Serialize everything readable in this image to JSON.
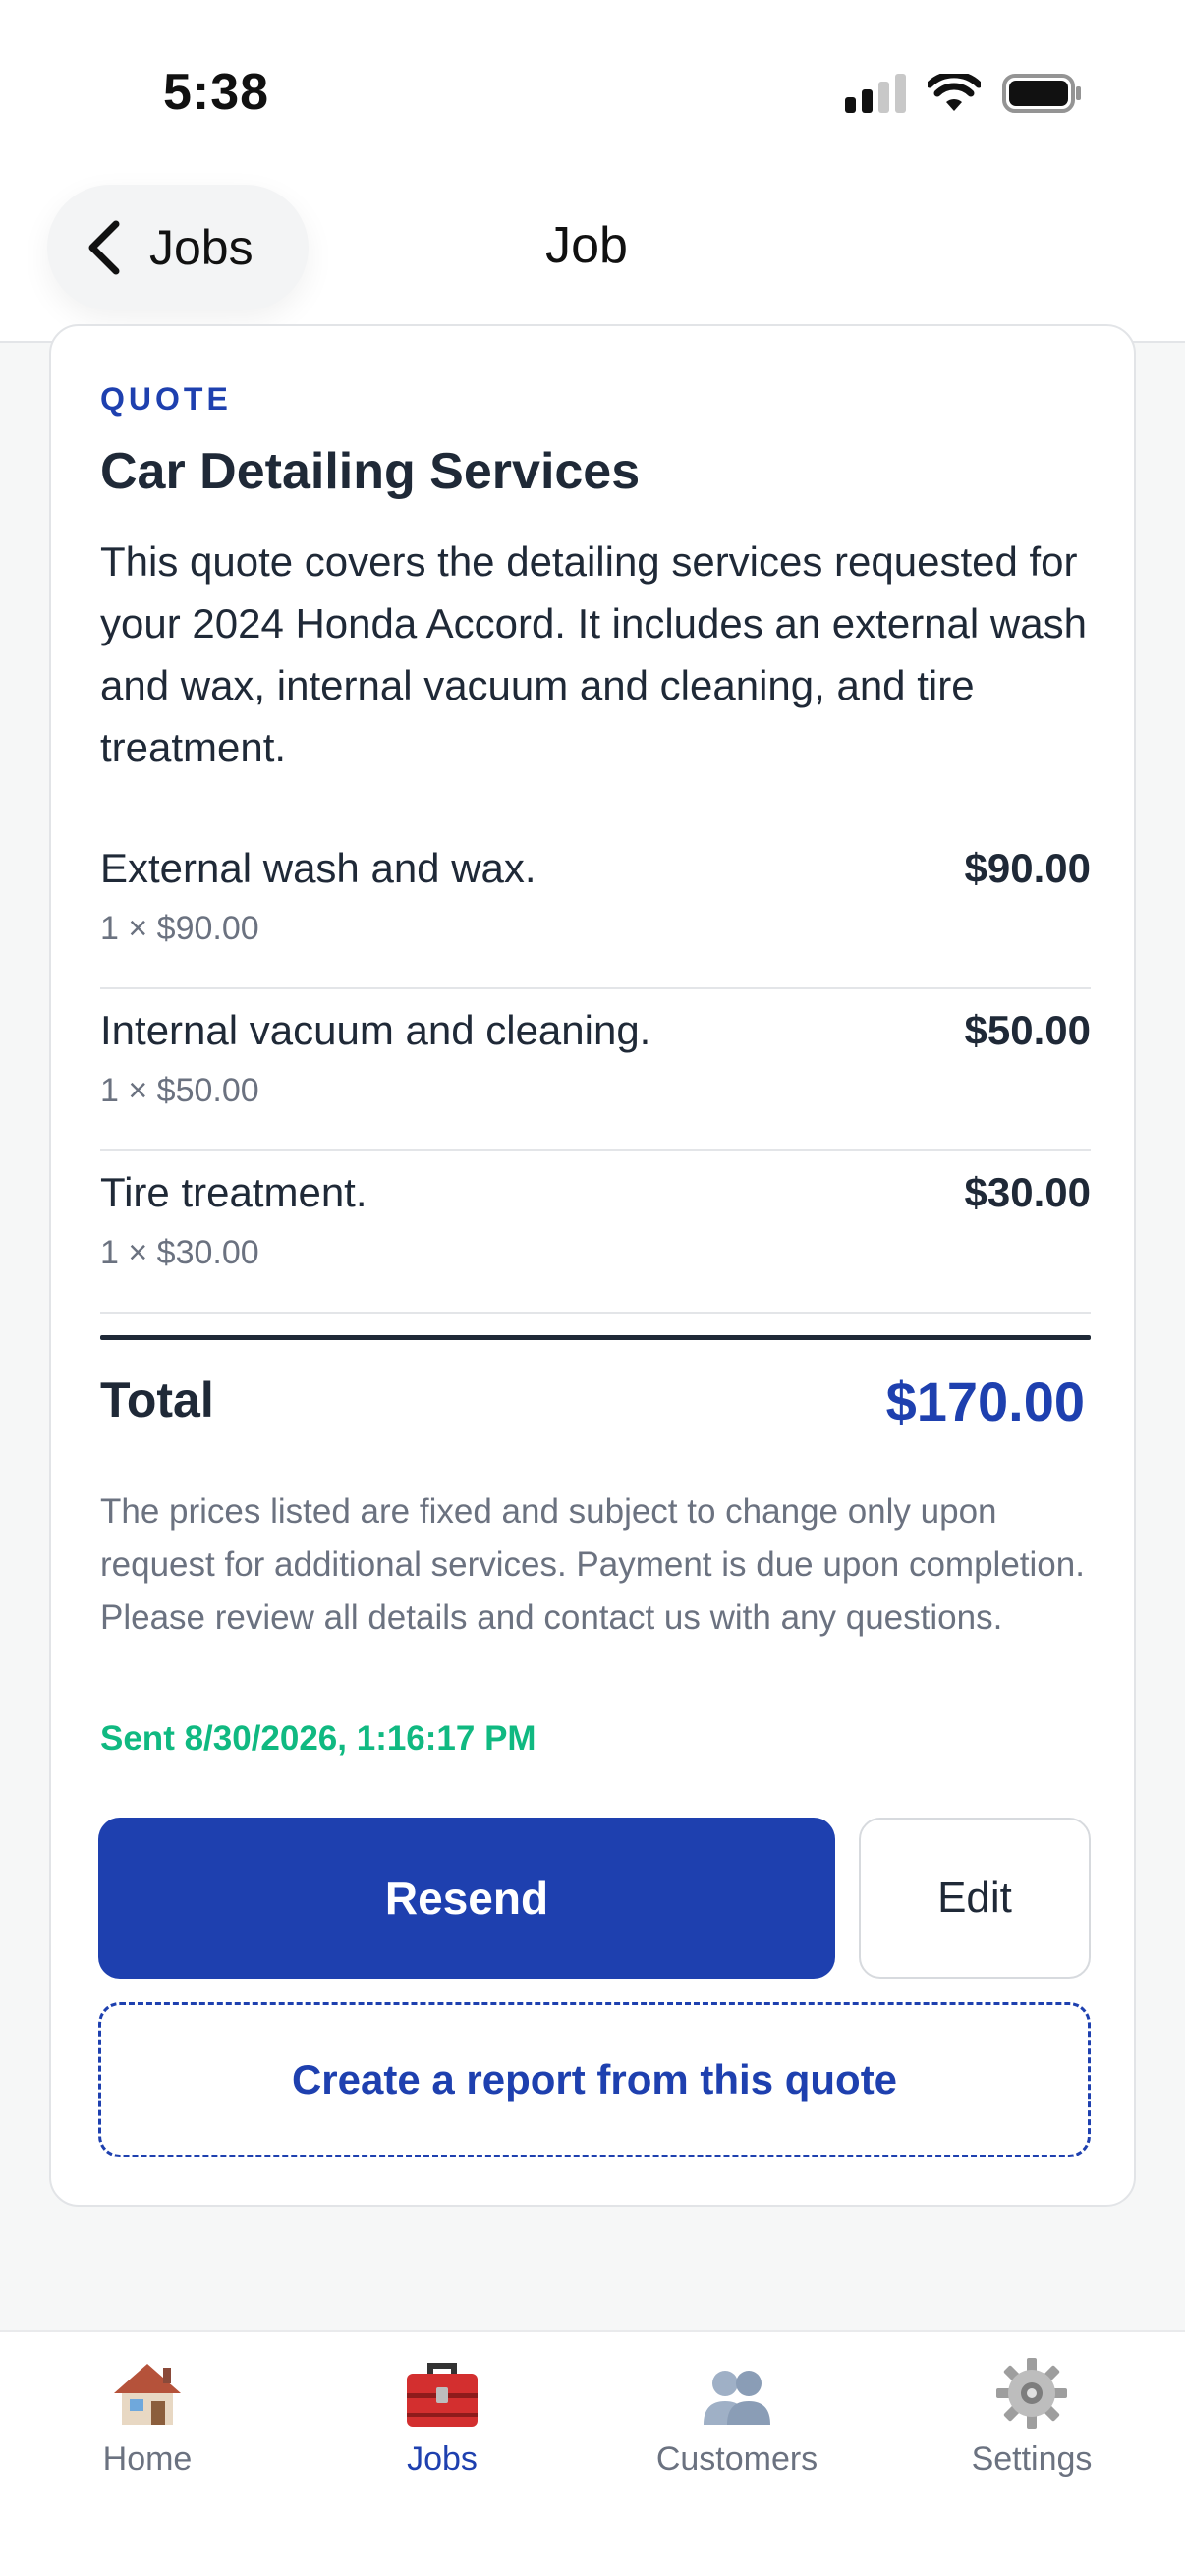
{
  "status_bar": {
    "time": "5:38"
  },
  "nav": {
    "back_label": "Jobs",
    "title": "Job"
  },
  "quote": {
    "eyebrow": "QUOTE",
    "title": "Car Detailing Services",
    "description": "This quote covers the detailing services requested for your 2024 Honda Accord. It includes an external wash and wax, internal vacuum and cleaning, and tire treatment.",
    "line_items": [
      {
        "name": "External wash and wax.",
        "qty_price": "1 × $90.00",
        "amount": "$90.00"
      },
      {
        "name": "Internal vacuum and cleaning.",
        "qty_price": "1 × $50.00",
        "amount": "$50.00"
      },
      {
        "name": "Tire treatment.",
        "qty_price": "1 × $30.00",
        "amount": "$30.00"
      }
    ],
    "total_label": "Total",
    "total_value": "$170.00",
    "terms": "The prices listed are fixed and subject to change only upon request for additional services. Payment is due upon completion. Please review all details and contact us with any questions.",
    "sent": "Sent 8/30/2026, 1:16:17 PM",
    "resend_label": "Resend",
    "edit_label": "Edit",
    "report_label": "Create a report from this quote"
  },
  "tabbar": {
    "items": [
      {
        "label": "Home",
        "icon": "house-icon",
        "active": false
      },
      {
        "label": "Jobs",
        "icon": "toolbox-icon",
        "active": true
      },
      {
        "label": "Customers",
        "icon": "people-icon",
        "active": false
      },
      {
        "label": "Settings",
        "icon": "gear-icon",
        "active": false
      }
    ]
  },
  "colors": {
    "accent": "#1e40af",
    "sent_green": "#10b981",
    "text": "#1f2937",
    "muted": "#6b7280"
  }
}
